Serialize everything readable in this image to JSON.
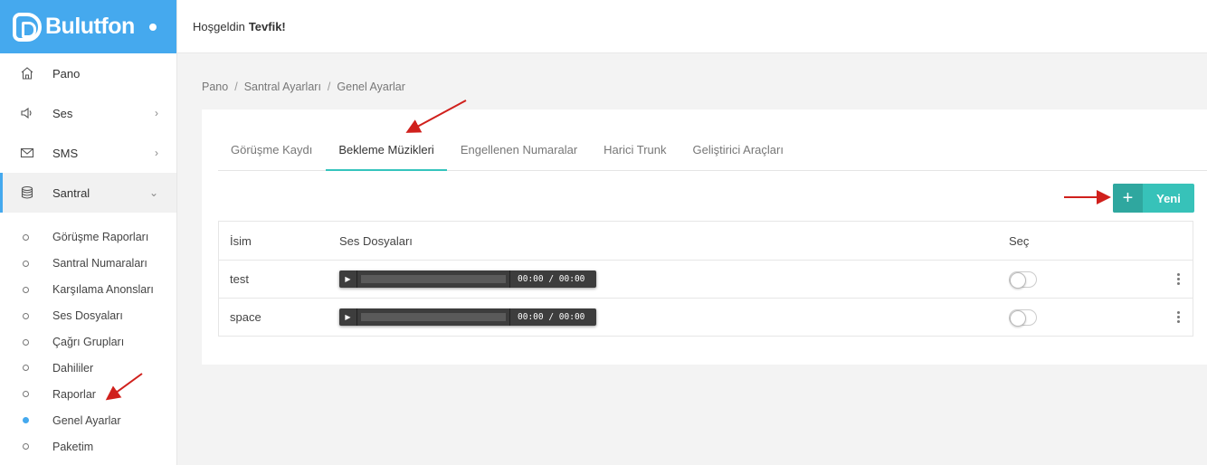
{
  "brand": {
    "name": "Bulutfon"
  },
  "header": {
    "greeting": "Hoşgeldin",
    "user": "Tevfik!"
  },
  "sidebar": {
    "items": [
      {
        "label": "Pano",
        "icon": "home-icon"
      },
      {
        "label": "Ses",
        "icon": "speaker-icon"
      },
      {
        "label": "SMS",
        "icon": "mail-icon"
      },
      {
        "label": "Santral",
        "icon": "database-icon"
      }
    ],
    "subitems": [
      "Görüşme Raporları",
      "Santral Numaraları",
      "Karşılama Anonsları",
      "Ses Dosyaları",
      "Çağrı Grupları",
      "Dahililer",
      "Raporlar",
      "Genel Ayarlar",
      "Paketim"
    ],
    "current_subitem": "Genel Ayarlar"
  },
  "breadcrumb": [
    "Pano",
    "Santral Ayarları",
    "Genel Ayarlar"
  ],
  "tabs": [
    "Görüşme Kaydı",
    "Bekleme Müzikleri",
    "Engellenen Numaralar",
    "Harici Trunk",
    "Geliştirici Araçları"
  ],
  "active_tab": "Bekleme Müzikleri",
  "new_button": {
    "label": "Yeni",
    "icon": "plus-icon"
  },
  "table": {
    "columns": [
      "İsim",
      "Ses Dosyaları",
      "Seç"
    ],
    "rows": [
      {
        "name": "test",
        "time": "00:00",
        "duration": "00:00",
        "selected": false
      },
      {
        "name": "space",
        "time": "00:00",
        "duration": "00:00",
        "selected": false
      }
    ]
  },
  "colors": {
    "brand": "#45a9ee",
    "accent": "#37c2b9",
    "arrow": "#d0201c"
  }
}
